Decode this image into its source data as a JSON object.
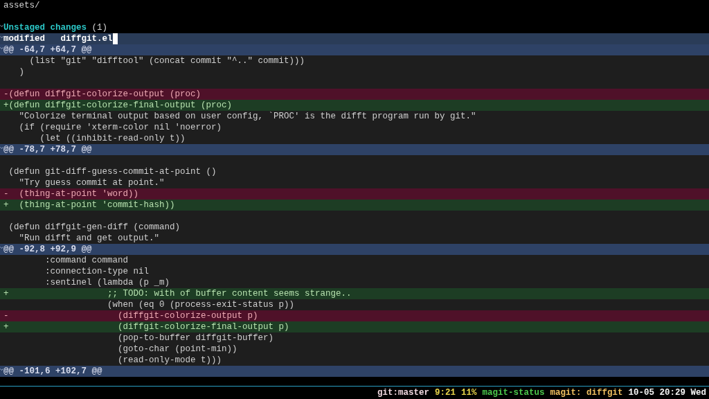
{
  "buffer": {
    "lines": [
      {
        "kind": "plain",
        "text": "assets/"
      },
      {
        "kind": "blank"
      },
      {
        "kind": "section",
        "expanded": true,
        "title": "Unstaged changes",
        "count": "(1)"
      },
      {
        "kind": "file",
        "expanded": true,
        "text": "modified   diffgit.el",
        "cursor": true
      },
      {
        "kind": "hunk",
        "expanded": true,
        "text": "@@ -64,7 +64,7 @@"
      },
      {
        "kind": "context",
        "text": "     (list \"git\" \"difftool\" (concat commit \"^..\" commit)))"
      },
      {
        "kind": "context",
        "text": "   )"
      },
      {
        "kind": "context-blank"
      },
      {
        "kind": "removed",
        "text": "-(defun diffgit-colorize-output (proc)"
      },
      {
        "kind": "added",
        "text": "+(defun diffgit-colorize-final-output (proc)"
      },
      {
        "kind": "context",
        "text": "   \"Colorize terminal output based on user config, `PROC' is the difft program run by git.\""
      },
      {
        "kind": "context",
        "text": "   (if (require 'xterm-color nil 'noerror)"
      },
      {
        "kind": "context",
        "text": "       (let ((inhibit-read-only t))"
      },
      {
        "kind": "hunk",
        "expanded": true,
        "text": "@@ -78,7 +78,7 @@"
      },
      {
        "kind": "context-blank"
      },
      {
        "kind": "context",
        "text": " (defun git-diff-guess-commit-at-point ()"
      },
      {
        "kind": "context",
        "text": "   \"Try guess commit at point.\""
      },
      {
        "kind": "removed",
        "text": "-  (thing-at-point 'word))"
      },
      {
        "kind": "added",
        "text": "+  (thing-at-point 'commit-hash))"
      },
      {
        "kind": "context-blank"
      },
      {
        "kind": "context",
        "text": " (defun diffgit-gen-diff (command)"
      },
      {
        "kind": "context",
        "text": "   \"Run difft and get output.\""
      },
      {
        "kind": "hunk",
        "expanded": true,
        "text": "@@ -92,8 +92,9 @@"
      },
      {
        "kind": "context",
        "text": "        :command command"
      },
      {
        "kind": "context",
        "text": "        :connection-type nil"
      },
      {
        "kind": "context",
        "text": "        :sentinel (lambda (p _m)"
      },
      {
        "kind": "added",
        "text": "+                   ;; TODO: with of buffer content seems strange.."
      },
      {
        "kind": "context",
        "text": "                    (when (eq 0 (process-exit-status p))"
      },
      {
        "kind": "removed",
        "text": "-                     (diffgit-colorize-output p)"
      },
      {
        "kind": "added",
        "text": "+                     (diffgit-colorize-final-output p)"
      },
      {
        "kind": "context",
        "text": "                      (pop-to-buffer diffgit-buffer)"
      },
      {
        "kind": "context",
        "text": "                      (goto-char (point-min))"
      },
      {
        "kind": "context",
        "text": "                      (read-only-mode t)))"
      },
      {
        "kind": "hunk",
        "expanded": true,
        "text": "@@ -101,6 +102,7 @@"
      }
    ]
  },
  "mode_line": {
    "segments": [
      {
        "text": "git:master",
        "color": "#f0d8e0"
      },
      {
        "text": "9:21",
        "color": "#e8d44a"
      },
      {
        "text": "11%",
        "color": "#e8d44a"
      },
      {
        "text": "magit-status",
        "color": "#4cc84c"
      },
      {
        "text": "magit: diffgit",
        "color": "#f0c060"
      },
      {
        "text": "10-05 20:29 Wed",
        "color": "#f4f4f4"
      }
    ]
  }
}
